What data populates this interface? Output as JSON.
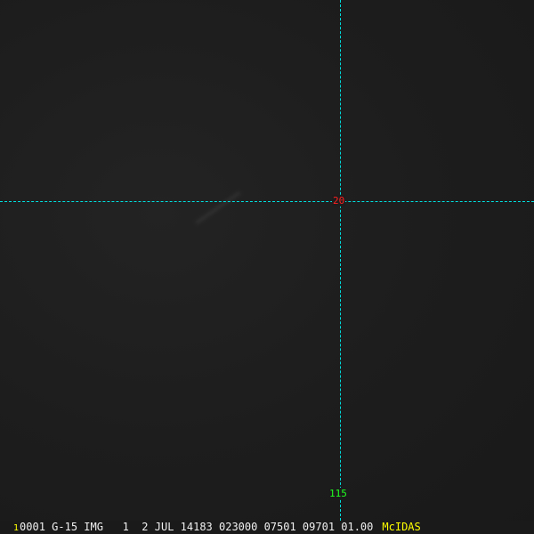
{
  "image": {
    "grid_labels": {
      "latitude": "20",
      "longitude": "115"
    },
    "status_bar": {
      "frame_number": "1",
      "info": "0001 G-15 IMG   1  2 JUL 14183 023000 07501 09701 01.00",
      "brand": "McIDAS"
    }
  },
  "colors": {
    "grid": "#00e0e0",
    "latitude_label": "#ff2020",
    "longitude_label": "#20ff20",
    "brand": "#ffff00"
  }
}
